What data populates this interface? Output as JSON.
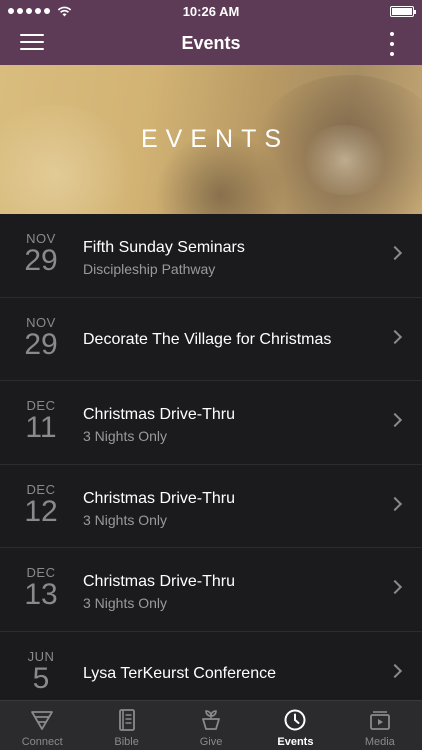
{
  "status_bar": {
    "time": "10:26 AM"
  },
  "nav": {
    "title": "Events"
  },
  "hero": {
    "title": "EVENTS"
  },
  "events": [
    {
      "month": "NOV",
      "day": "29",
      "title": "Fifth Sunday Seminars",
      "subtitle": "Discipleship Pathway"
    },
    {
      "month": "NOV",
      "day": "29",
      "title": "Decorate The Village for Christmas",
      "subtitle": ""
    },
    {
      "month": "DEC",
      "day": "11",
      "title": "Christmas Drive-Thru",
      "subtitle": "3 Nights Only"
    },
    {
      "month": "DEC",
      "day": "12",
      "title": "Christmas Drive-Thru",
      "subtitle": "3 Nights Only"
    },
    {
      "month": "DEC",
      "day": "13",
      "title": "Christmas Drive-Thru",
      "subtitle": "3 Nights Only"
    },
    {
      "month": "JUN",
      "day": "5",
      "title": "Lysa TerKeurst Conference",
      "subtitle": ""
    }
  ],
  "tabs": [
    {
      "label": "Connect",
      "icon": "connect-icon",
      "active": false
    },
    {
      "label": "Bible",
      "icon": "bible-icon",
      "active": false
    },
    {
      "label": "Give",
      "icon": "give-icon",
      "active": false
    },
    {
      "label": "Events",
      "icon": "clock-icon",
      "active": true
    },
    {
      "label": "Media",
      "icon": "media-icon",
      "active": false
    }
  ],
  "colors": {
    "brand": "#5d3a56",
    "background": "#1b1b1d",
    "tabbar": "#2b2b2e"
  }
}
